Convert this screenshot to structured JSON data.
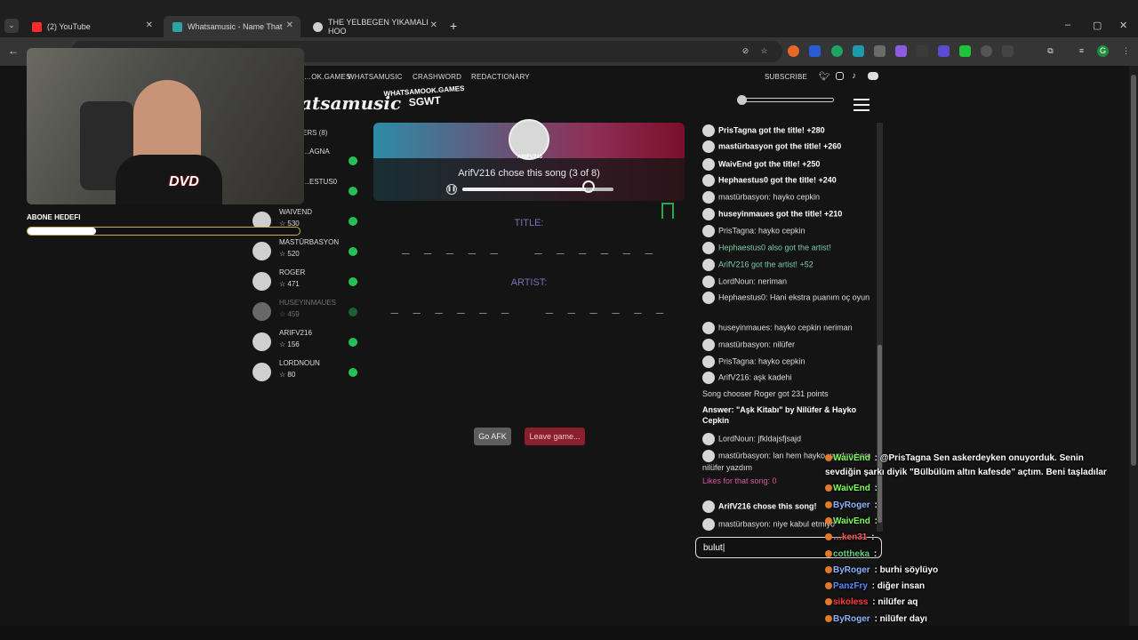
{
  "browser": {
    "tabs": [
      {
        "title": "(2) YouTube",
        "color": "#ff2b2b"
      },
      {
        "title": "Whatsamusic - Name That",
        "color": "#2aa3a3"
      },
      {
        "title": "THE YELBEGEN YIKAMALI HOO",
        "color": "#cfcfcf"
      }
    ],
    "window": {
      "minimize": "–",
      "maximize": "▢",
      "close": "✕"
    },
    "new_tab": "+",
    "back": "←"
  },
  "site": {
    "nav": [
      "…OK.GAMES",
      "WHATSAMUSIC",
      "CRASHWORD",
      "REDACTIONARY"
    ],
    "subscribe": "SUBSCRIBE",
    "logo": "atsamusic",
    "sgwt_top": "WHATSAMOOK.GAMES",
    "sgwt_bottom": "SGWT",
    "players_header": "ERS (8)"
  },
  "stream": {
    "abone_label": "ABONE HEDEFI",
    "abone_progress": 0.25,
    "dvd": "DVD"
  },
  "players": [
    {
      "name": "…AGNA",
      "score": ""
    },
    {
      "name": "…ESTUS0",
      "score": ""
    },
    {
      "name": "WAIVEND",
      "score": "530"
    },
    {
      "name": "MASTÜRBASYON",
      "score": "520"
    },
    {
      "name": "ROGER",
      "score": "471"
    },
    {
      "name": "HUSEYINMAUES",
      "score": "459"
    },
    {
      "name": "ARIFV216",
      "score": "156"
    },
    {
      "name": "LORDNOUN",
      "score": "80"
    }
  ],
  "song": {
    "chooser": "ARIFV216",
    "status": "ArifV216 chose this song (3 of 8)",
    "title_label": "TITLE:",
    "title_blanks": "_ _ _ _ _   _ _ _ _ _ _",
    "artist_label": "ARTIST:",
    "artist_blanks": "_ _ _ _ _ _   _ _ _ _ _ _",
    "progress": 0.82
  },
  "buttons": {
    "afk": "Go AFK",
    "leave": "Leave game..."
  },
  "chat": [
    {
      "text": "PrisTagna got the title! +280",
      "style": "b",
      "avatar": true
    },
    {
      "text": "mastürbasyon got the title! +260",
      "style": "b",
      "avatar": true
    },
    {
      "text": "WaivEnd got the title! +250",
      "style": "b",
      "avatar": true
    },
    {
      "text": "Hephaestus0 got the title! +240",
      "style": "b",
      "avatar": true
    },
    {
      "text": "mastürbasyon: hayko cepkin",
      "style": "n",
      "avatar": true
    },
    {
      "text": "huseyinmaues got the title! +210",
      "style": "b",
      "avatar": true
    },
    {
      "text": "PrisTagna: hayko cepkin",
      "style": "n",
      "avatar": true
    },
    {
      "text": "Hephaestus0 also got the artist!",
      "style": "art",
      "avatar": true
    },
    {
      "text": "ArifV216 got the artist! +52",
      "style": "art",
      "avatar": true
    },
    {
      "text": "LordNoun: neriman",
      "style": "n",
      "avatar": true
    },
    {
      "text": "Hephaestus0: Hani ekstra puanım oç oyun",
      "style": "n",
      "avatar": true
    },
    {
      "text": "huseyinmaues: hayko cepkin neriman",
      "style": "n",
      "avatar": true
    },
    {
      "text": "mastürbasyon: nilüfer",
      "style": "n",
      "avatar": true
    },
    {
      "text": "PrisTagna: hayko cepkin",
      "style": "n",
      "avatar": true
    },
    {
      "text": "ArifV216: aşk kadehi",
      "style": "n",
      "avatar": true
    },
    {
      "text": "Song chooser Roger got 231 points",
      "style": "n",
      "avatar": false
    },
    {
      "text": "Answer: \"Aşk Kitabı\" by Nilüfer & Hayko Cepkin",
      "style": "b",
      "avatar": false
    },
    {
      "text": "LordNoun: jfkldajsfjsajd",
      "style": "n",
      "avatar": true
    },
    {
      "text": "mastürbasyon: lan hem hayko yazdım hem nilüfer yazdım",
      "style": "n",
      "avatar": true
    },
    {
      "text": "Likes for that song: 0",
      "style": "pink",
      "avatar": false
    },
    {
      "text": "ArifV216 chose this song!",
      "style": "b",
      "avatar": true
    },
    {
      "text": "mastürbasyon: niye kabul etmiyo",
      "style": "n",
      "avatar": true
    }
  ],
  "chat_input": {
    "value": "bulut"
  },
  "twitch": [
    {
      "user": "WaivEnd",
      "color": "#7dff5a",
      "text": "@PrisTagna Sen askerdeyken onuyorduk. Senin sevdiğin şarkı diyik \"Bülbülüm altın kafesde\" açtım. Beni taşladılar"
    },
    {
      "user": "WaivEnd",
      "color": "#7dff5a",
      "text": ""
    },
    {
      "user": "ByRoger",
      "color": "#8fb4ff",
      "text": ""
    },
    {
      "user": "WaivEnd",
      "color": "#7dff5a",
      "text": ""
    },
    {
      "user": "…ken31",
      "color": "#ff5a5a",
      "text": ""
    },
    {
      "user": "cottheka",
      "color": "#5dd37a",
      "text": ""
    },
    {
      "user": "ByRoger",
      "color": "#8fb4ff",
      "text": "burhi söylüyo"
    },
    {
      "user": "PanzFry",
      "color": "#5a8cff",
      "text": "diğer insan"
    },
    {
      "user": "sikoless",
      "color": "#ff3c3c",
      "text": "nilüfer aq"
    },
    {
      "user": "ByRoger",
      "color": "#8fb4ff",
      "text": "nilüfer dayı"
    }
  ]
}
